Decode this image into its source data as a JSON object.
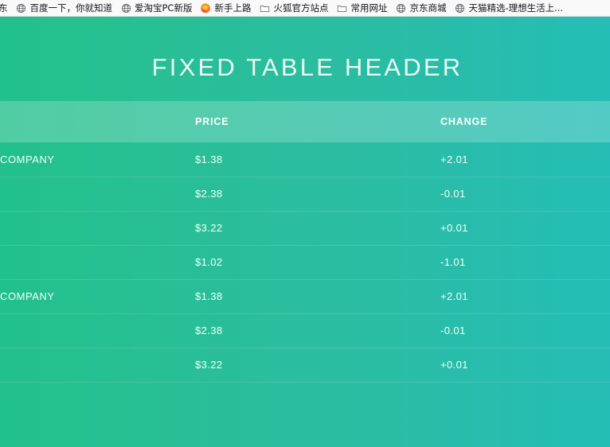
{
  "browser": {
    "bookmarks": [
      {
        "label": "东",
        "icon": "globe-icon",
        "clipped": true
      },
      {
        "label": "百度一下，你就知道",
        "icon": "globe-icon",
        "clipped": false
      },
      {
        "label": "爱淘宝PC新版",
        "icon": "globe-icon",
        "clipped": false
      },
      {
        "label": "新手上路",
        "icon": "firefox-icon",
        "clipped": false
      },
      {
        "label": "火狐官方站点",
        "icon": "folder-icon",
        "clipped": false
      },
      {
        "label": "常用网址",
        "icon": "folder-icon",
        "clipped": false
      },
      {
        "label": "京东商城",
        "icon": "globe-icon",
        "clipped": false
      },
      {
        "label": "天猫精选-理想生活上...",
        "icon": "globe-icon",
        "clipped": false
      }
    ]
  },
  "page": {
    "title": "FIXED TABLE HEADER",
    "colors": {
      "gradient_left": "#22c08c",
      "gradient_right": "#25bdb5",
      "header_row": "rgba(255,255,255,0.21)",
      "text": "#ffffff",
      "row_divider": "rgba(255,255,255,0.13)"
    }
  },
  "table": {
    "columns": [
      {
        "key": "company",
        "label": ""
      },
      {
        "key": "price",
        "label": "PRICE"
      },
      {
        "key": "change",
        "label": "CHANGE"
      }
    ],
    "rows": [
      {
        "company": "COMPANY",
        "price": "$1.38",
        "change": "+2.01"
      },
      {
        "company": "",
        "price": "$2.38",
        "change": "-0.01"
      },
      {
        "company": "",
        "price": "$3.22",
        "change": "+0.01"
      },
      {
        "company": "",
        "price": "$1.02",
        "change": "-1.01"
      },
      {
        "company": "COMPANY",
        "price": "$1.38",
        "change": "+2.01"
      },
      {
        "company": "",
        "price": "$2.38",
        "change": "-0.01"
      },
      {
        "company": "",
        "price": "$3.22",
        "change": "+0.01"
      }
    ]
  }
}
